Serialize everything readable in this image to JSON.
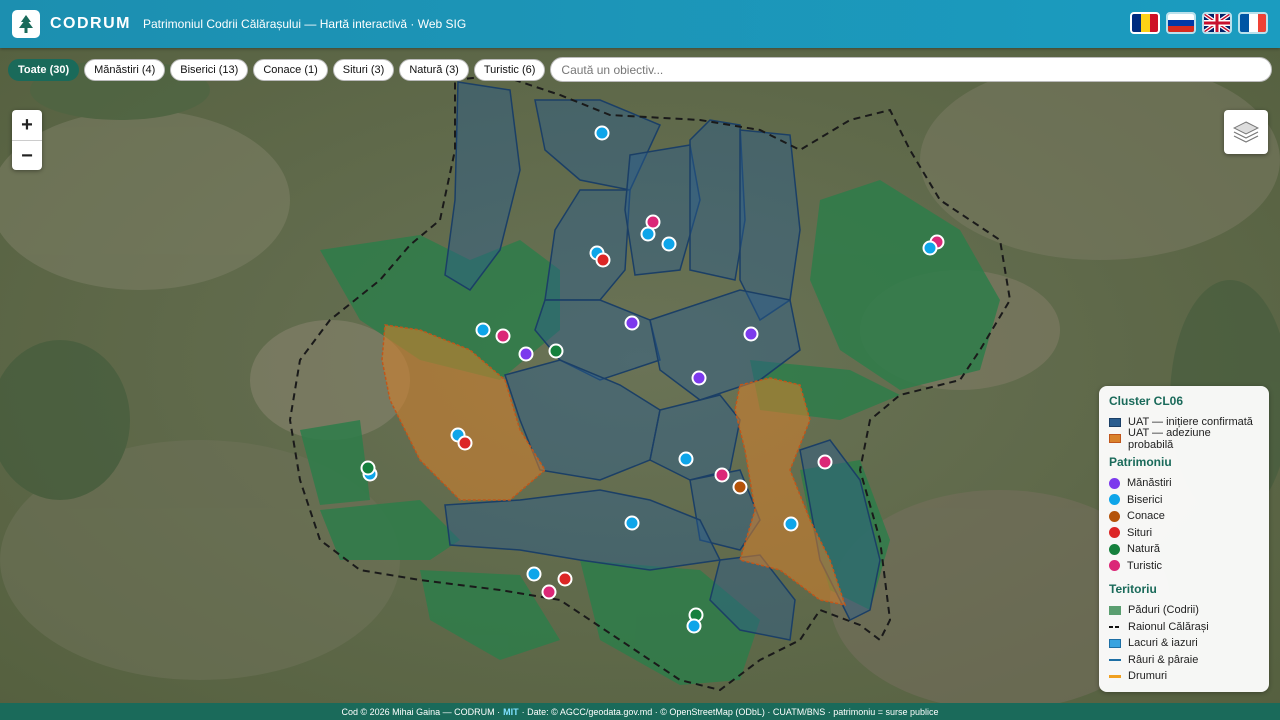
{
  "header": {
    "brand": "CODRUM",
    "subtitle": "Patrimoniul Codrii Călărașului — Hartă interactivă · Web SIG"
  },
  "filters": [
    {
      "label": "Toate (30)",
      "active": true
    },
    {
      "label": "Mănăstiri (4)"
    },
    {
      "label": "Biserici (13)"
    },
    {
      "label": "Conace (1)"
    },
    {
      "label": "Situri (3)"
    },
    {
      "label": "Natură (3)"
    },
    {
      "label": "Turistic (6)"
    }
  ],
  "search": {
    "placeholder": "Caută un obiectiv..."
  },
  "zoom": {
    "in": "+",
    "out": "−"
  },
  "legend": {
    "cluster_title": "Cluster CL06",
    "uat_confirmed": "UAT — inițiere confirmată",
    "uat_probable": "UAT — adeziune probabilă",
    "heritage_title": "Patrimoniu",
    "manastiri": "Mănăstiri",
    "biserici": "Biserici",
    "conace": "Conace",
    "situri": "Situri",
    "natura": "Natură",
    "turistic": "Turistic",
    "territory_title": "Teritoriu",
    "paduri": "Păduri (Codrii)",
    "raion": "Raionul Călărași",
    "lacuri": "Lacuri & iazuri",
    "rauri": "Râuri & pâraie",
    "drumuri": "Drumuri"
  },
  "colors": {
    "manastiri": "#7c3aed",
    "biserici": "#0ea5e9",
    "conace": "#b45309",
    "situri": "#dc2626",
    "natura": "#15803d",
    "turistic": "#db2777",
    "uat_confirmed": "#2a5d8f",
    "uat_probable": "#d9822b",
    "forest": "#2e7d4a"
  },
  "footer": {
    "left": "Cod © 2026 Mihai Gaina — CODRUM ·",
    "license": "MIT",
    "right": "· Date: © AGCC/geodata.gov.md · © OpenStreetMap (ODbL) · CUATM/BNS · patrimoniu = surse publice"
  }
}
